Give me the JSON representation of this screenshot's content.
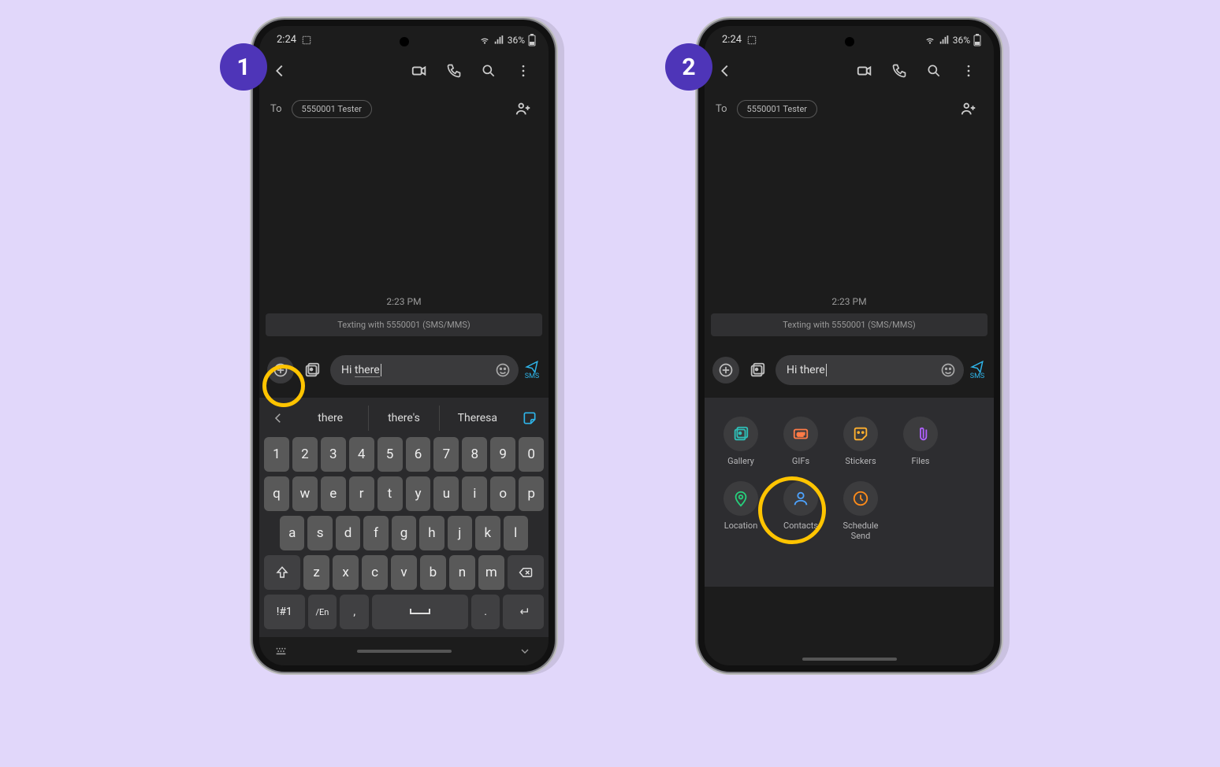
{
  "steps": [
    "1",
    "2"
  ],
  "status": {
    "time": "2:24",
    "battery": "36%"
  },
  "header": {
    "to_label": "To",
    "chip": "5550001 Tester"
  },
  "conv": {
    "time": "2:23 PM",
    "banner": "Texting with 5550001 (SMS/MMS)"
  },
  "compose": {
    "text_pre": "Hi ",
    "text_u": "there",
    "text2": "Hi there",
    "send": "SMS"
  },
  "suggest": {
    "a": "there",
    "b": "there's",
    "c": "Theresa"
  },
  "keys": {
    "r1": [
      "1",
      "2",
      "3",
      "4",
      "5",
      "6",
      "7",
      "8",
      "9",
      "0"
    ],
    "r2": [
      "q",
      "w",
      "e",
      "r",
      "t",
      "y",
      "u",
      "i",
      "o",
      "p"
    ],
    "r3": [
      "a",
      "s",
      "d",
      "f",
      "g",
      "h",
      "j",
      "k",
      "l"
    ],
    "r4": [
      "z",
      "x",
      "c",
      "v",
      "b",
      "n",
      "m"
    ],
    "sym": "!#1",
    "lang": "/En",
    "comma": ",",
    "period": "."
  },
  "attach": [
    {
      "id": "gallery",
      "label": "Gallery",
      "color": "#2ec0b8"
    },
    {
      "id": "gifs",
      "label": "GIFs",
      "color": "#ff7b47"
    },
    {
      "id": "stickers",
      "label": "Stickers",
      "color": "#ffb02e"
    },
    {
      "id": "files",
      "label": "Files",
      "color": "#b060ff"
    },
    {
      "id": "location",
      "label": "Location",
      "color": "#26d07c"
    },
    {
      "id": "contacts",
      "label": "Contacts",
      "color": "#4da3ff"
    },
    {
      "id": "schedule",
      "label": "Schedule Send",
      "color": "#ff8c1a"
    }
  ]
}
